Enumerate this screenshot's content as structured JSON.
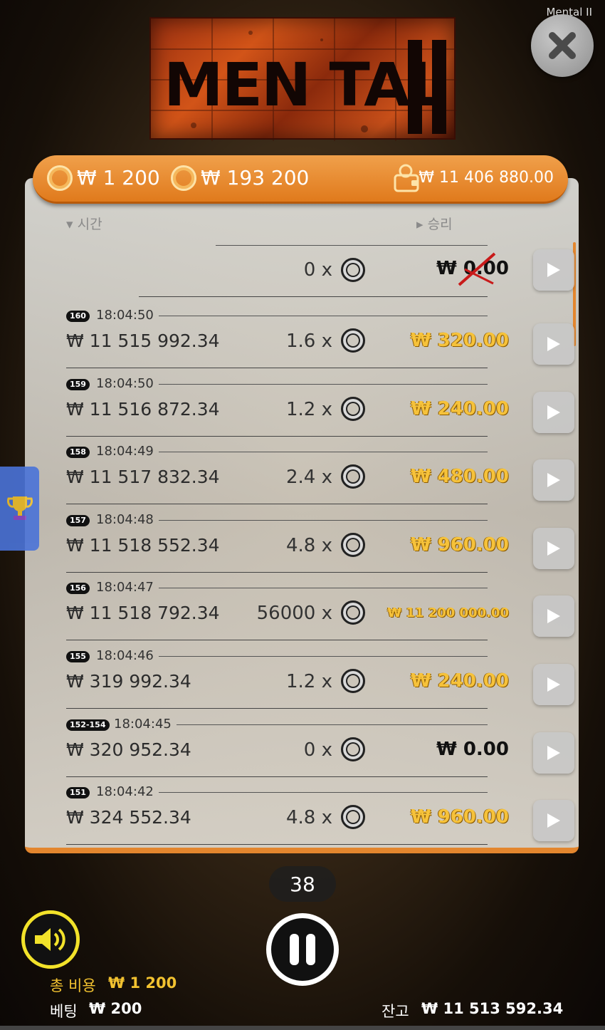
{
  "window": {
    "title": "Mental II"
  },
  "logo": {
    "text": "MEN TAL"
  },
  "topbar": {
    "bet": "₩ 1 200",
    "total_win": "₩ 193 200",
    "balance": "₩ 11 406 880.00"
  },
  "columns": {
    "time": "시간",
    "win": "승리"
  },
  "current_spin": {
    "multiplier": "0 x",
    "win": "₩ 0.00"
  },
  "history": [
    {
      "id": "160",
      "time": "18:04:50",
      "balance": "₩ 11 515 992.34",
      "multiplier": "1.6 x",
      "win": "₩ 320.00",
      "style": "gold"
    },
    {
      "id": "159",
      "time": "18:04:50",
      "balance": "₩ 11 516 872.34",
      "multiplier": "1.2 x",
      "win": "₩ 240.00",
      "style": "gold"
    },
    {
      "id": "158",
      "time": "18:04:49",
      "balance": "₩ 11 517 832.34",
      "multiplier": "2.4 x",
      "win": "₩ 480.00",
      "style": "gold"
    },
    {
      "id": "157",
      "time": "18:04:48",
      "balance": "₩ 11 518 552.34",
      "multiplier": "4.8 x",
      "win": "₩ 960.00",
      "style": "gold"
    },
    {
      "id": "156",
      "time": "18:04:47",
      "balance": "₩ 11 518 792.34",
      "multiplier": "56000 x",
      "win": "₩ 11 200 000.00",
      "style": "gold small"
    },
    {
      "id": "155",
      "time": "18:04:46",
      "balance": "₩ 319 992.34",
      "multiplier": "1.2 x",
      "win": "₩ 240.00",
      "style": "gold"
    },
    {
      "id": "152-154",
      "time": "18:04:45",
      "balance": "₩ 320 952.34",
      "multiplier": "0 x",
      "win": "₩ 0.00",
      "style": "black"
    },
    {
      "id": "151",
      "time": "18:04:42",
      "balance": "₩ 324 552.34",
      "multiplier": "4.8 x",
      "win": "₩ 960.00",
      "style": "gold"
    }
  ],
  "autoplay": {
    "remaining": "38"
  },
  "footer": {
    "total_cost_label": "총 비용",
    "total_cost_value": "₩ 1 200",
    "bet_label": "베팅",
    "bet_value": "₩ 200",
    "balance_label": "잔고",
    "balance_value": "₩ 11 513 592.34"
  },
  "colors": {
    "accent": "#e68a2e",
    "gold": "#f6c23a",
    "sound": "#f2e22a",
    "sidetab": "#4a73d8"
  },
  "icons": [
    "close-icon",
    "coin-icon",
    "wallet-icon",
    "play-icon",
    "trophy-icon",
    "pause-icon",
    "speaker-icon"
  ]
}
